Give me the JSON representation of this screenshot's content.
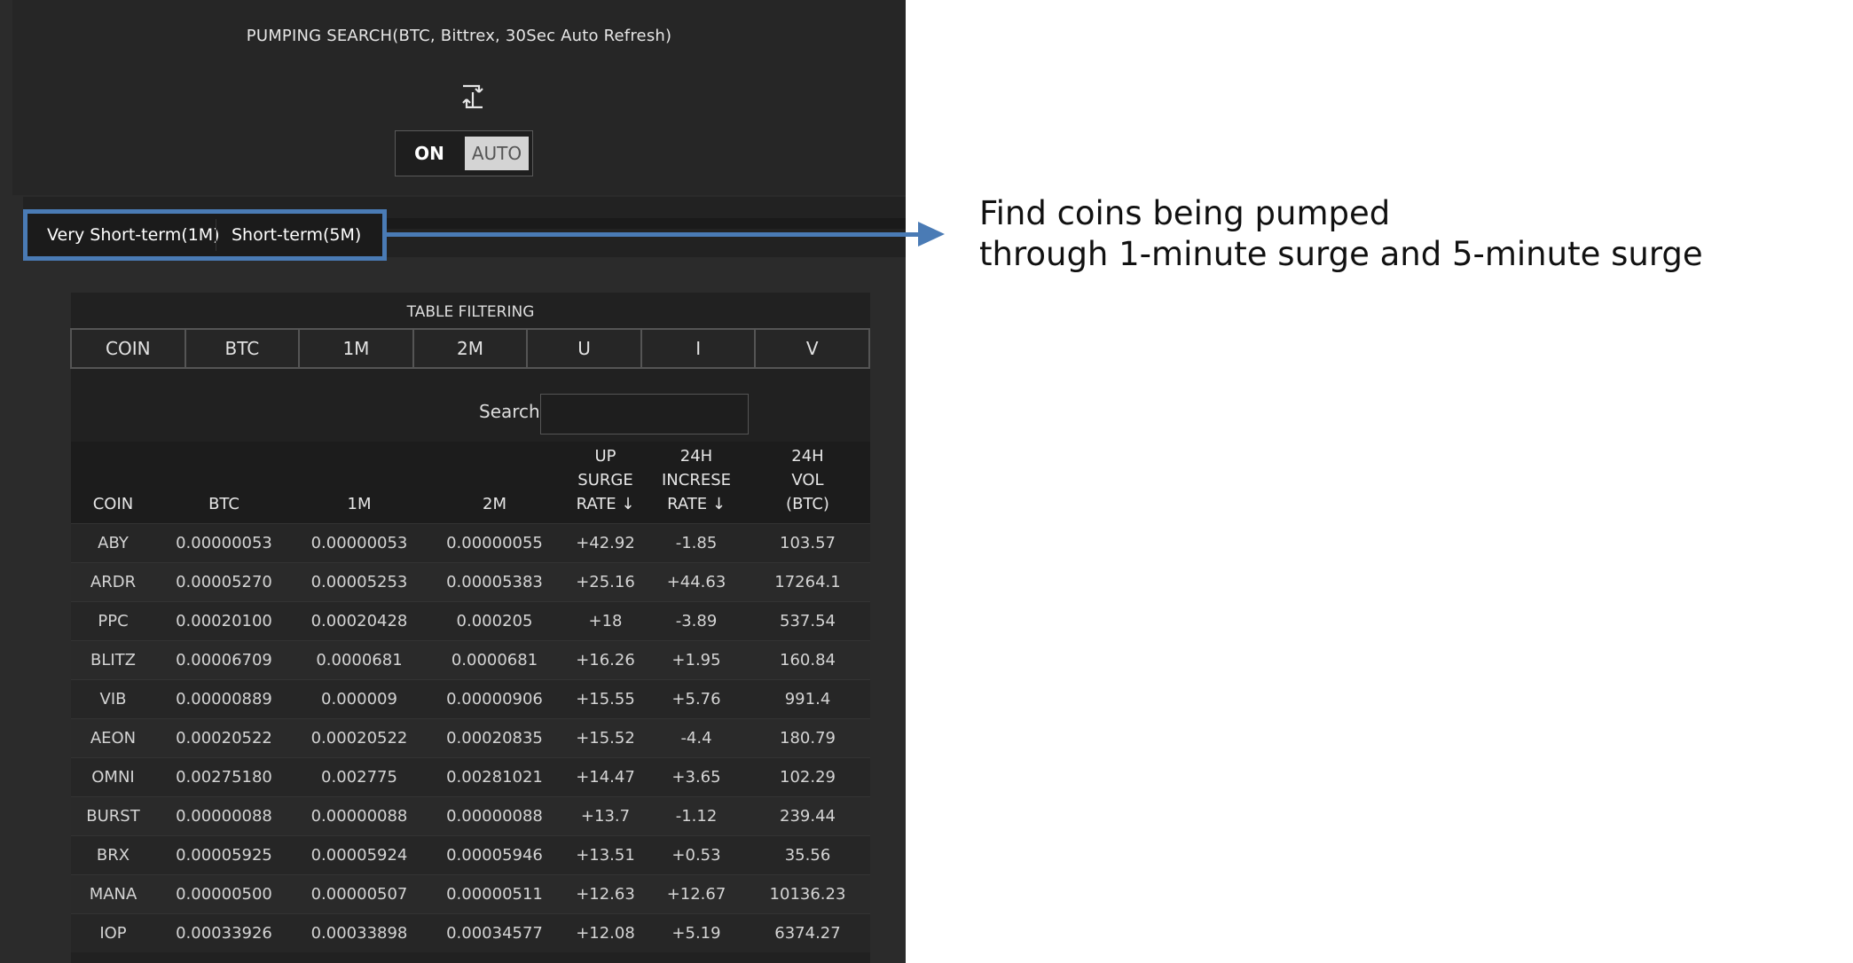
{
  "header": {
    "title": "PUMPING SEARCH(BTC, Bittrex, 30Sec Auto Refresh)",
    "icon": "refresh-icon",
    "toggle": {
      "on_label": "ON",
      "auto_label": "AUTO"
    }
  },
  "tabs": [
    {
      "label": "Very Short-term(1M)"
    },
    {
      "label": "Short-term(5M)"
    }
  ],
  "annotation": {
    "line1": "Find coins being pumped",
    "line2": "through 1-minute surge and 5-minute surge"
  },
  "filtering": {
    "title": "TABLE FILTERING",
    "buttons": [
      "COIN",
      "BTC",
      "1M",
      "2M",
      "U",
      "I",
      "V"
    ]
  },
  "search": {
    "label": "Search:",
    "value": ""
  },
  "table": {
    "headers": {
      "coin": "COIN",
      "btc": "BTC",
      "m1": "1M",
      "m2": "2M",
      "up": [
        "UP",
        "SURGE",
        "RATE ↓"
      ],
      "inc": [
        "24H",
        "INCRESE",
        "RATE ↓"
      ],
      "vol": [
        "24H",
        "VOL",
        "(BTC)"
      ]
    },
    "colors": {
      "white": "#d6d6d6",
      "red": "#e8403f",
      "blue": "#4b8fd8"
    },
    "rows": [
      {
        "coin": "ABY",
        "btc": "0.00000053",
        "btc_c": "white",
        "m1": "0.00000053",
        "m1_c": "blue",
        "m2": "0.00000055",
        "up": "+42.92",
        "inc": "-1.85",
        "inc_c": "blue",
        "vol": "103.57"
      },
      {
        "coin": "ARDR",
        "btc": "0.00005270",
        "btc_c": "red",
        "m1": "0.00005253",
        "m1_c": "blue",
        "m2": "0.00005383",
        "up": "+25.16",
        "inc": "+44.63",
        "inc_c": "red",
        "vol": "17264.1"
      },
      {
        "coin": "PPC",
        "btc": "0.00020100",
        "btc_c": "blue",
        "m1": "0.00020428",
        "m1_c": "blue",
        "m2": "0.000205",
        "up": "+18",
        "inc": "-3.89",
        "inc_c": "blue",
        "vol": "537.54"
      },
      {
        "coin": "BLITZ",
        "btc": "0.00006709",
        "btc_c": "blue",
        "m1": "0.0000681",
        "m1_c": "white",
        "m2": "0.0000681",
        "up": "+16.26",
        "inc": "+1.95",
        "inc_c": "red",
        "vol": "160.84"
      },
      {
        "coin": "VIB",
        "btc": "0.00000889",
        "btc_c": "blue",
        "m1": "0.000009",
        "m1_c": "blue",
        "m2": "0.00000906",
        "up": "+15.55",
        "inc": "+5.76",
        "inc_c": "red",
        "vol": "991.4"
      },
      {
        "coin": "AEON",
        "btc": "0.00020522",
        "btc_c": "white",
        "m1": "0.00020522",
        "m1_c": "blue",
        "m2": "0.00020835",
        "up": "+15.52",
        "inc": "-4.4",
        "inc_c": "blue",
        "vol": "180.79"
      },
      {
        "coin": "OMNI",
        "btc": "0.00275180",
        "btc_c": "blue",
        "m1": "0.002775",
        "m1_c": "blue",
        "m2": "0.00281021",
        "up": "+14.47",
        "inc": "+3.65",
        "inc_c": "red",
        "vol": "102.29"
      },
      {
        "coin": "BURST",
        "btc": "0.00000088",
        "btc_c": "white",
        "m1": "0.00000088",
        "m1_c": "white",
        "m2": "0.00000088",
        "up": "+13.7",
        "inc": "-1.12",
        "inc_c": "blue",
        "vol": "239.44"
      },
      {
        "coin": "BRX",
        "btc": "0.00005925",
        "btc_c": "red",
        "m1": "0.00005924",
        "m1_c": "blue",
        "m2": "0.00005946",
        "up": "+13.51",
        "inc": "+0.53",
        "inc_c": "red",
        "vol": "35.56"
      },
      {
        "coin": "MANA",
        "btc": "0.00000500",
        "btc_c": "blue",
        "m1": "0.00000507",
        "m1_c": "blue",
        "m2": "0.00000511",
        "up": "+12.63",
        "inc": "+12.67",
        "inc_c": "red",
        "vol": "10136.23"
      },
      {
        "coin": "IOP",
        "btc": "0.00033926",
        "btc_c": "red",
        "m1": "0.00033898",
        "m1_c": "blue",
        "m2": "0.00034577",
        "up": "+12.08",
        "inc": "+5.19",
        "inc_c": "red",
        "vol": "6374.27"
      }
    ]
  }
}
